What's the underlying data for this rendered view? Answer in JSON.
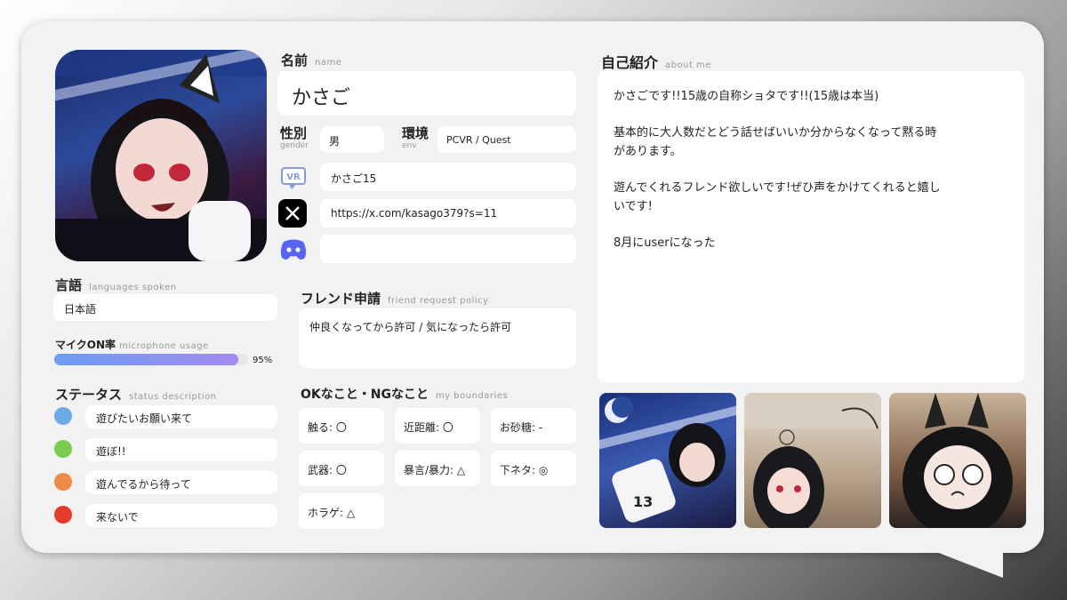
{
  "profile": {
    "name_label": "名前",
    "name_sub": "name",
    "name_value": "かさご",
    "gender_label": "性別",
    "gender_sub": "gender",
    "gender_value": "男",
    "env_label": "環境",
    "env_sub": "env",
    "env_value": "PCVR / Quest",
    "vrchat_value": "かさご15",
    "x_value": "https://x.com/kasago379?s=11",
    "discord_value": ""
  },
  "languages": {
    "label": "言語",
    "sub": "languages spoken",
    "value": "日本語"
  },
  "mic": {
    "label": "マイクON率",
    "sub": "microphone usage",
    "percent_text": "95%",
    "percent": 95
  },
  "status": {
    "label": "ステータス",
    "sub": "status description",
    "items": [
      {
        "color": "#6aaae6",
        "text": "遊びたいお願い来て"
      },
      {
        "color": "#7acb4e",
        "text": "遊ぼ!!"
      },
      {
        "color": "#f08a4a",
        "text": "遊んでるから待って"
      },
      {
        "color": "#e63a2a",
        "text": "来ないで"
      }
    ]
  },
  "friend": {
    "label": "フレンド申請",
    "sub": "friend request policy",
    "value": "仲良くなってから許可 / 気になったら許可"
  },
  "boundaries": {
    "label": "OKなこと・NGなこと",
    "sub": "my boundaries",
    "items": [
      "触る: 〇",
      "近距離: 〇",
      "お砂糖: -",
      "武器: 〇",
      "暴言/暴力: △",
      "下ネタ: ◎",
      "ホラゲ: △"
    ]
  },
  "about": {
    "label": "自己紹介",
    "sub": "about me",
    "lines": [
      "かさごです!!15歳の自称ショタです!!(15歳は本当)",
      "基本的に大人数だとどう話せばいいか分からなくなって黙る時",
      "があります。",
      "遊んでくれるフレンド欲しいです!ぜひ声をかけてくれると嬉し",
      "いです!",
      "8月にuserになった"
    ]
  },
  "icons": {
    "vr": "vrchat-icon",
    "x": "x-logo-icon",
    "discord": "discord-icon"
  }
}
